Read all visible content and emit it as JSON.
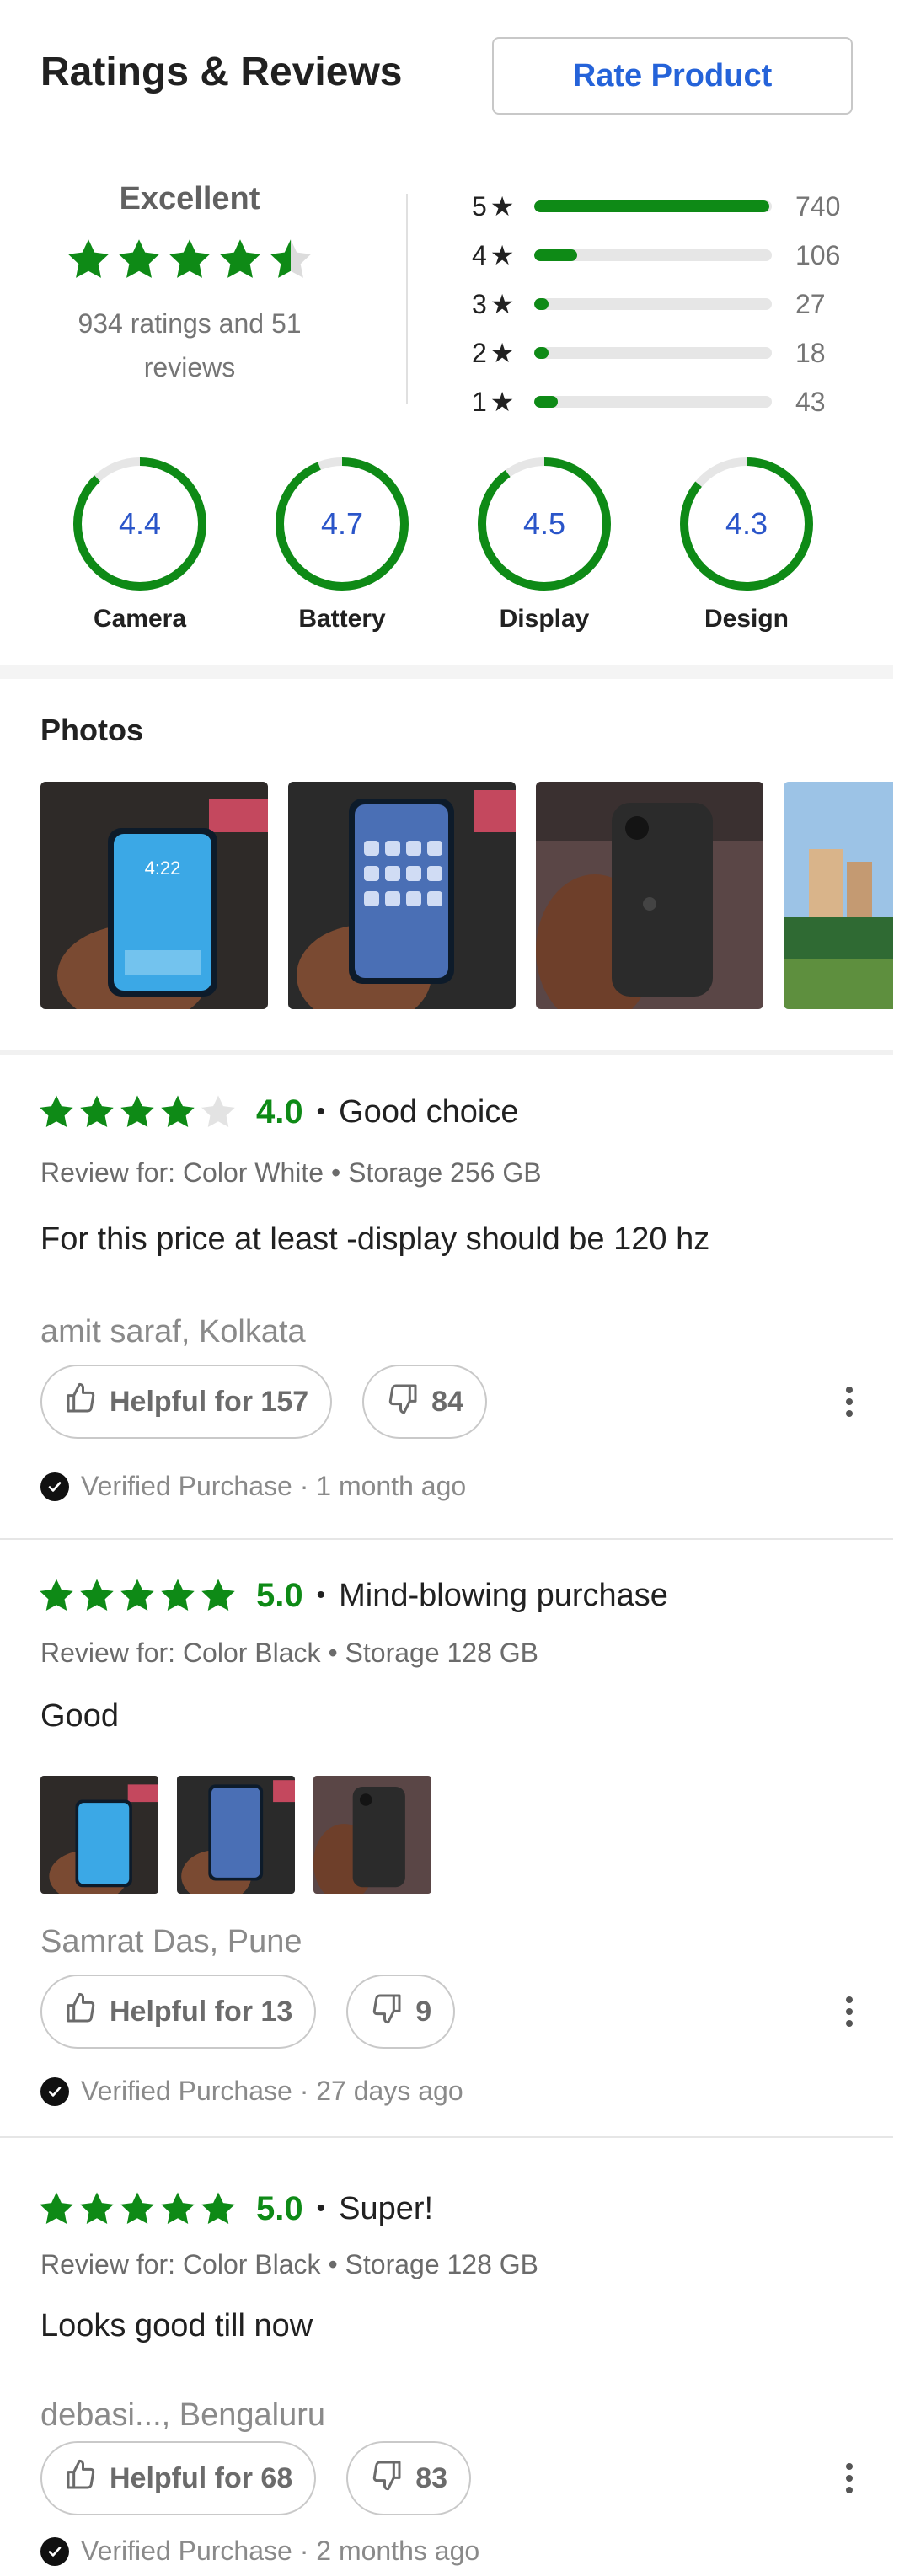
{
  "header": {
    "title": "Ratings & Reviews",
    "rate_button": "Rate Product"
  },
  "summary": {
    "verdict": "Excellent",
    "average_stars": 4.5,
    "count_text": "934 ratings and 51 reviews",
    "distribution": [
      {
        "stars": "5",
        "count": "740",
        "fraction": 0.99
      },
      {
        "stars": "4",
        "count": "106",
        "fraction": 0.18
      },
      {
        "stars": "3",
        "count": "27",
        "fraction": 0.06
      },
      {
        "stars": "2",
        "count": "18",
        "fraction": 0.06
      },
      {
        "stars": "1",
        "count": "43",
        "fraction": 0.1
      }
    ]
  },
  "features": [
    {
      "label": "Camera",
      "value": "4.4",
      "score": 4.4
    },
    {
      "label": "Battery",
      "value": "4.7",
      "score": 4.7
    },
    {
      "label": "Display",
      "value": "4.5",
      "score": 4.5
    },
    {
      "label": "Design",
      "value": "4.3",
      "score": 4.3
    }
  ],
  "photos": {
    "title": "Photos"
  },
  "reviews": [
    {
      "rating": "4.0",
      "stars": 4,
      "title": "Good choice",
      "variant": "Review for: Color White • Storage 256 GB",
      "text": "For this price at least -display should be 120 hz",
      "author": "amit saraf, Kolkata",
      "helpful": "Helpful for 157",
      "dislikes": "84",
      "verified": "Verified Purchase · 1 month ago"
    },
    {
      "rating": "5.0",
      "stars": 5,
      "title": "Mind-blowing purchase",
      "variant": "Review for: Color Black • Storage 128 GB",
      "text": "Good",
      "author": "Samrat Das, Pune",
      "helpful": "Helpful for 13",
      "dislikes": "9",
      "verified": "Verified Purchase · 27 days ago"
    },
    {
      "rating": "5.0",
      "stars": 5,
      "title": "Super!",
      "variant": "Review for: Color Black • Storage 128 GB",
      "text": "Looks good till now",
      "author": "debasi..., Bengaluru",
      "helpful": "Helpful for 68",
      "dislikes": "83",
      "verified": "Verified Purchase · 2 months ago"
    }
  ],
  "colors": {
    "accent_green": "#0e8a16",
    "link_blue": "#2563d9",
    "ring_green": "#0e8a16"
  },
  "icons": {
    "star": "star-icon",
    "thumbs_up": "thumbs-up-icon",
    "thumbs_down": "thumbs-down-icon",
    "more": "more-vertical-icon",
    "verified": "check-circle-icon"
  }
}
